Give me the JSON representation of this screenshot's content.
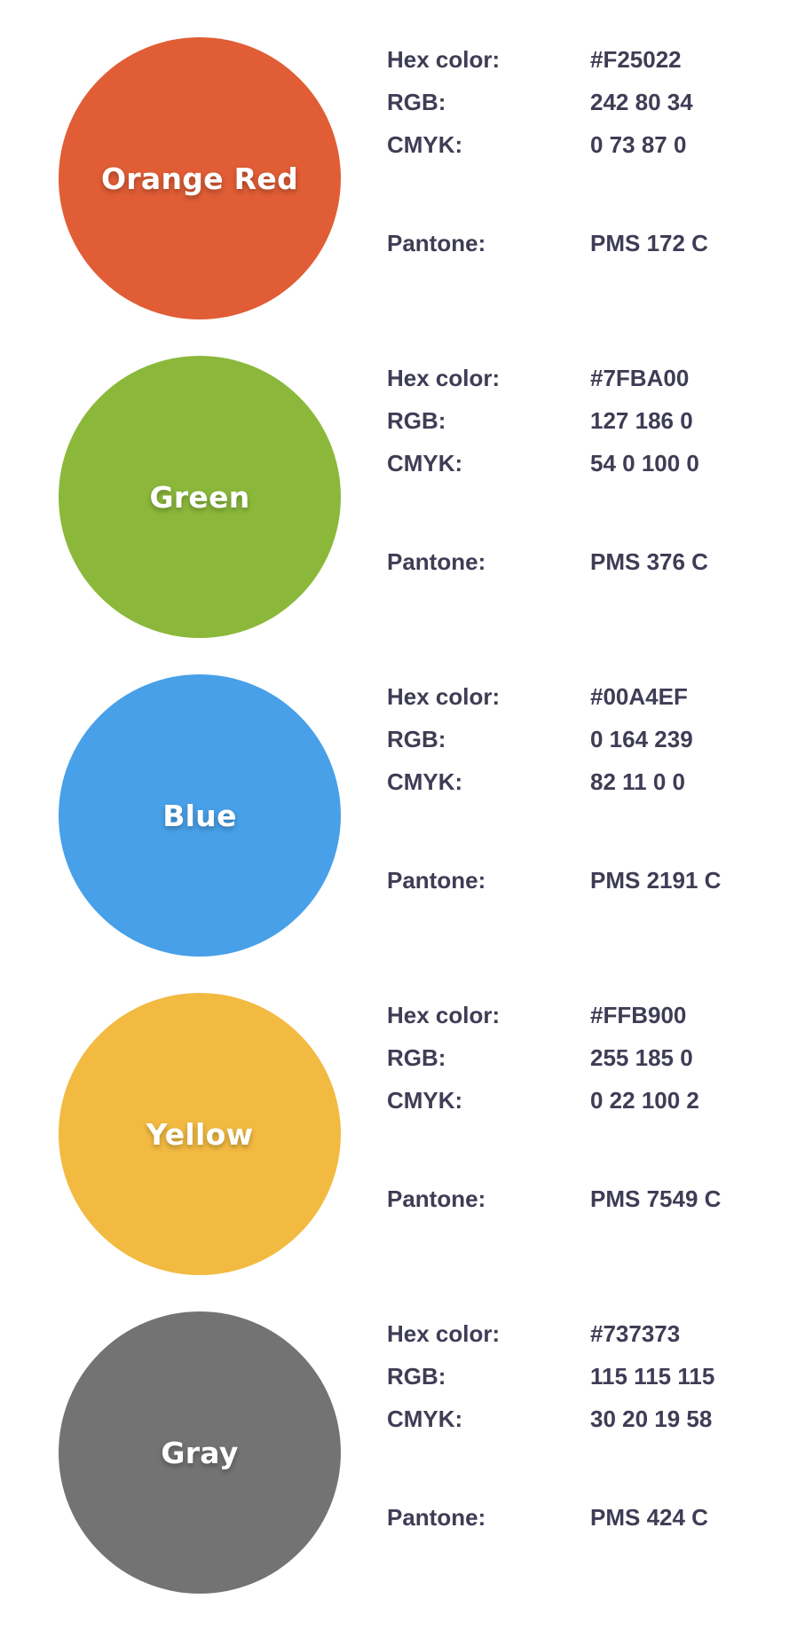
{
  "labels": {
    "hex": "Hex color:",
    "rgb": "RGB:",
    "cmyk": "CMYK:",
    "pantone": "Pantone:"
  },
  "swatches": [
    {
      "name": "Orange Red",
      "color": "#E05D35",
      "hex": "#F25022",
      "rgb": "242 80 34",
      "cmyk": "0 73 87 0",
      "pantone": "PMS 172 C"
    },
    {
      "name": "Green",
      "color": "#8BB83A",
      "hex": "#7FBA00",
      "rgb": "127 186 0",
      "cmyk": "54 0 100 0",
      "pantone": "PMS 376 C"
    },
    {
      "name": "Blue",
      "color": "#47A0E8",
      "hex": "#00A4EF",
      "rgb": "0 164 239",
      "cmyk": "82 11 0 0",
      "pantone": "PMS 2191 C"
    },
    {
      "name": "Yellow",
      "color": "#F2BA41",
      "hex": "#FFB900",
      "rgb": "255 185 0",
      "cmyk": "0 22 100 2",
      "pantone": "PMS 7549 C"
    },
    {
      "name": "Gray",
      "color": "#737373",
      "hex": "#737373",
      "rgb": "115 115 115",
      "cmyk": "30 20 19 58",
      "pantone": "PMS 424 C"
    }
  ]
}
